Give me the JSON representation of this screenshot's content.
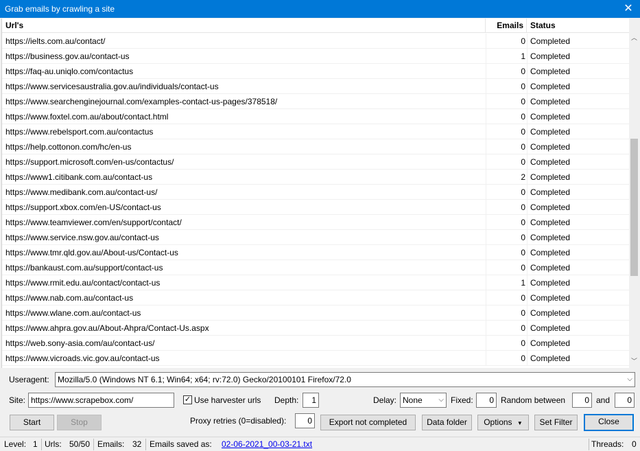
{
  "window": {
    "title": "Grab emails by crawling a site"
  },
  "columns": {
    "url": "Url's",
    "emails": "Emails",
    "status": "Status"
  },
  "rows": [
    {
      "url": "https://ielts.com.au/contact/",
      "emails": "0",
      "status": "Completed"
    },
    {
      "url": "https://business.gov.au/contact-us",
      "emails": "1",
      "status": "Completed"
    },
    {
      "url": "https://faq-au.uniqlo.com/contactus",
      "emails": "0",
      "status": "Completed"
    },
    {
      "url": "https://www.servicesaustralia.gov.au/individuals/contact-us",
      "emails": "0",
      "status": "Completed"
    },
    {
      "url": "https://www.searchenginejournal.com/examples-contact-us-pages/378518/",
      "emails": "0",
      "status": "Completed"
    },
    {
      "url": "https://www.foxtel.com.au/about/contact.html",
      "emails": "0",
      "status": "Completed"
    },
    {
      "url": "https://www.rebelsport.com.au/contactus",
      "emails": "0",
      "status": "Completed"
    },
    {
      "url": "https://help.cottonon.com/hc/en-us",
      "emails": "0",
      "status": "Completed"
    },
    {
      "url": "https://support.microsoft.com/en-us/contactus/",
      "emails": "0",
      "status": "Completed"
    },
    {
      "url": "https://www1.citibank.com.au/contact-us",
      "emails": "2",
      "status": "Completed"
    },
    {
      "url": "https://www.medibank.com.au/contact-us/",
      "emails": "0",
      "status": "Completed"
    },
    {
      "url": "https://support.xbox.com/en-US/contact-us",
      "emails": "0",
      "status": "Completed"
    },
    {
      "url": "https://www.teamviewer.com/en/support/contact/",
      "emails": "0",
      "status": "Completed"
    },
    {
      "url": "https://www.service.nsw.gov.au/contact-us",
      "emails": "0",
      "status": "Completed"
    },
    {
      "url": "https://www.tmr.qld.gov.au/About-us/Contact-us",
      "emails": "0",
      "status": "Completed"
    },
    {
      "url": "https://bankaust.com.au/support/contact-us",
      "emails": "0",
      "status": "Completed"
    },
    {
      "url": "https://www.rmit.edu.au/contact/contact-us",
      "emails": "1",
      "status": "Completed"
    },
    {
      "url": "https://www.nab.com.au/contact-us",
      "emails": "0",
      "status": "Completed"
    },
    {
      "url": "https://www.wlane.com.au/contact-us",
      "emails": "0",
      "status": "Completed"
    },
    {
      "url": "https://www.ahpra.gov.au/About-Ahpra/Contact-Us.aspx",
      "emails": "0",
      "status": "Completed"
    },
    {
      "url": "https://web.sony-asia.com/au/contact-us/",
      "emails": "0",
      "status": "Completed"
    },
    {
      "url": "https://www.vicroads.vic.gov.au/contact-us",
      "emails": "0",
      "status": "Completed"
    }
  ],
  "scrollbar": {
    "position_fraction": 0.55
  },
  "controls": {
    "useragent_label": "Useragent:",
    "useragent_value": "Mozilla/5.0 (Windows NT 6.1; Win64; x64; rv:72.0) Gecko/20100101 Firefox/72.0",
    "site_label": "Site:",
    "site_value": "https://www.scrapebox.com/",
    "use_harvester_label": "Use harvester urls",
    "use_harvester_checked": true,
    "depth_label": "Depth:",
    "depth_value": "1",
    "delay_label": "Delay:",
    "delay_value": "None",
    "fixed_label": "Fixed:",
    "fixed_value": "0",
    "random_label": "Random between",
    "random_min": "0",
    "and_label": "and",
    "random_max": "0",
    "proxy_retries_label": "Proxy retries (0=disabled):",
    "proxy_retries_value": "0"
  },
  "buttons": {
    "start": "Start",
    "stop": "Stop",
    "export": "Export not completed",
    "data_folder": "Data folder",
    "options": "Options",
    "set_filter": "Set Filter",
    "close": "Close"
  },
  "statusbar": {
    "level_label": "Level:",
    "level_value": "1",
    "urls_label": "Urls:",
    "urls_value": "50/50",
    "emails_label": "Emails:",
    "emails_value": "32",
    "saved_label": "Emails saved as:",
    "saved_file": "02-06-2021_00-03-21.txt",
    "threads_label": "Threads:",
    "threads_value": "0"
  },
  "icons": {
    "close": "close-icon",
    "scroll_up": "chevron-up-icon",
    "scroll_down": "chevron-down-icon",
    "dropdown": "chevron-down-icon"
  },
  "colors": {
    "titlebar": "#0078d7",
    "link": "#0000ee",
    "default_button_border": "#0078d7"
  }
}
